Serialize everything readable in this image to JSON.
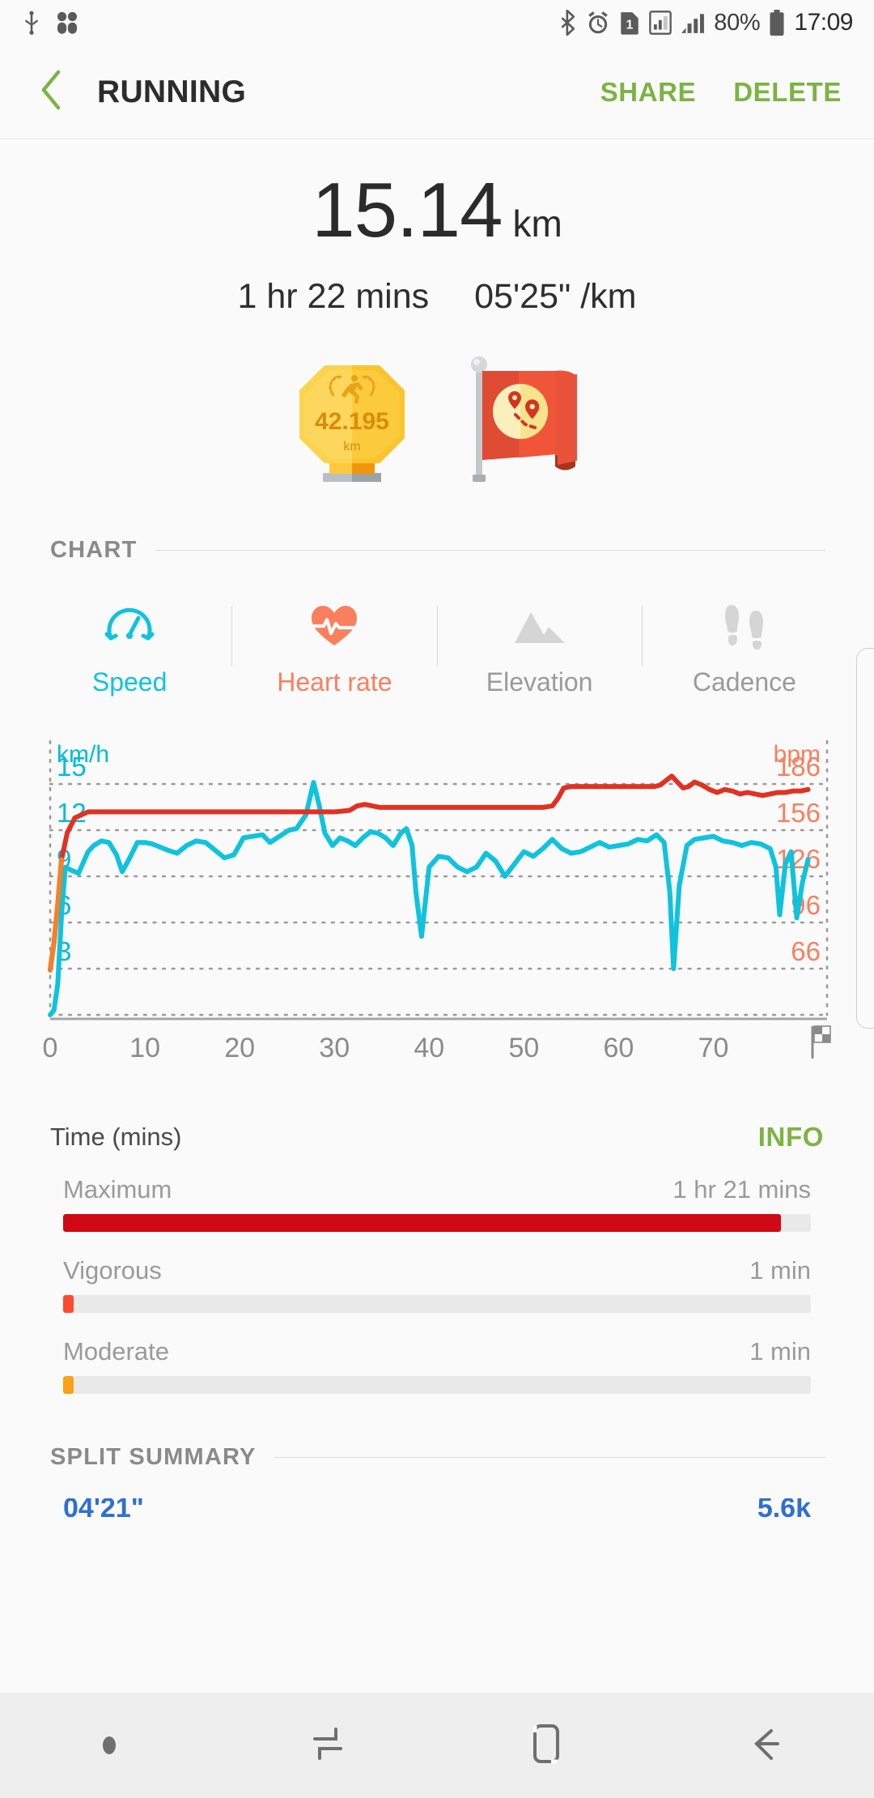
{
  "statusbar": {
    "time": "17:09",
    "battery_percent": "80%",
    "left_icons": [
      "usb-debug-icon",
      "apps-icon"
    ],
    "right_icons": [
      "bluetooth-icon",
      "alarm-icon",
      "sim-1-icon",
      "sd-card-icon",
      "signal-icon",
      "battery-icon"
    ]
  },
  "appbar": {
    "back_icon": "back-chevron-icon",
    "title": "RUNNING",
    "share_label": "SHARE",
    "delete_label": "DELETE",
    "accent_color": "#7cb342"
  },
  "summary": {
    "distance_value": "15.14",
    "distance_unit": "km",
    "duration": "1 hr 22 mins",
    "pace": "05'25\" /km"
  },
  "badges": [
    {
      "name": "marathon-medal-badge",
      "value": "42.195",
      "unit": "km"
    },
    {
      "name": "route-flag-badge",
      "value": "",
      "unit": ""
    }
  ],
  "chart_section": {
    "title": "CHART",
    "tabs": [
      {
        "label": "Speed",
        "icon": "speedometer-icon",
        "color": "#00bcd4",
        "active": true
      },
      {
        "label": "Heart rate",
        "icon": "heart-pulse-icon",
        "color": "#fa7f5e",
        "active": false
      },
      {
        "label": "Elevation",
        "icon": "mountain-icon",
        "color": "#9e9e9e",
        "active": false
      },
      {
        "label": "Cadence",
        "icon": "footsteps-icon",
        "color": "#9e9e9e",
        "active": false
      }
    ],
    "info_label": "INFO"
  },
  "chart_data": {
    "type": "line",
    "title": "",
    "xlabel": "Time (mins)",
    "x_ticks": [
      "0",
      "10",
      "20",
      "30",
      "40",
      "50",
      "60",
      "70"
    ],
    "x_end_marker": "finish-flag-icon",
    "xlim": [
      0,
      82
    ],
    "grid": true,
    "legend_position": "tabs-above",
    "axes": [
      {
        "side": "left",
        "unit_label": "km/h",
        "color": "#00bcd4",
        "ticks": [
          15,
          12,
          9,
          6,
          3
        ],
        "ylim": [
          0,
          16
        ]
      },
      {
        "side": "right",
        "unit_label": "bpm",
        "color": "#fa7f5e",
        "ticks": [
          186,
          156,
          126,
          96,
          66
        ],
        "ylim": [
          36,
          201
        ]
      }
    ],
    "series": [
      {
        "name": "Speed",
        "axis": "left",
        "unit": "km/h",
        "color": "#0fc3dd",
        "x": [
          0.0,
          0.4,
          0.8,
          1.2,
          1.6,
          2.2,
          3.0,
          4.0,
          4.6,
          5.4,
          6.2,
          7.0,
          7.6,
          8.4,
          9.2,
          10.0,
          10.8,
          11.6,
          12.4,
          13.4,
          14.4,
          15.4,
          16.4,
          17.4,
          18.4,
          19.4,
          20.4,
          21.4,
          22.4,
          23.2,
          24.2,
          25.2,
          26.0,
          27.0,
          27.8,
          28.4,
          29.0,
          29.8,
          30.6,
          31.4,
          32.2,
          33.0,
          33.8,
          34.6,
          35.4,
          36.2,
          37.0,
          37.6,
          38.2,
          38.6,
          39.2,
          40.0,
          41.0,
          42.0,
          43.0,
          44.0,
          45.0,
          46.0,
          47.0,
          48.0,
          49.0,
          50.0,
          51.0,
          52.0,
          53.0,
          54.0,
          55.0,
          56.0,
          57.0,
          58.0,
          59.0,
          60.0,
          61.0,
          62.0,
          63.0,
          64.0,
          64.8,
          65.4,
          65.8,
          66.4,
          67.2,
          68.0,
          69.0,
          70.0,
          71.0,
          72.0,
          73.0,
          74.0,
          75.0,
          76.0,
          76.6,
          77.0,
          77.6,
          78.2,
          78.8,
          79.4,
          80.0
        ],
        "y": [
          0.0,
          0.3,
          2.0,
          6.5,
          9.6,
          9.4,
          9.2,
          10.6,
          11.0,
          11.3,
          11.2,
          10.4,
          9.3,
          10.2,
          11.2,
          11.2,
          11.1,
          10.9,
          10.7,
          10.5,
          11.0,
          11.3,
          11.2,
          10.7,
          10.2,
          10.4,
          11.5,
          11.6,
          11.7,
          11.2,
          11.6,
          12.0,
          12.1,
          13.0,
          15.1,
          13.6,
          11.8,
          11.0,
          11.5,
          11.3,
          11.0,
          11.5,
          11.9,
          11.8,
          11.5,
          11.0,
          11.8,
          12.1,
          11.0,
          8.0,
          5.1,
          9.6,
          10.3,
          10.2,
          9.6,
          9.3,
          9.6,
          10.5,
          10.0,
          9.0,
          9.8,
          10.6,
          10.3,
          10.8,
          11.4,
          10.8,
          10.5,
          10.6,
          10.9,
          11.2,
          10.9,
          11.0,
          11.1,
          11.4,
          11.3,
          11.7,
          11.2,
          8.0,
          3.0,
          8.4,
          11.0,
          11.4,
          11.5,
          11.6,
          11.3,
          11.2,
          11.0,
          11.2,
          11.1,
          10.8,
          9.6,
          6.5,
          9.8,
          10.6,
          6.3,
          8.6,
          10.1
        ],
        "style": "solid",
        "width": 6
      },
      {
        "name": "Heart rate",
        "axis": "right",
        "unit": "bpm",
        "color": "#e23122",
        "x": [
          0.0,
          0.4,
          0.8,
          1.2,
          1.8,
          2.6,
          4.0,
          10.0,
          18.0,
          26.0,
          30.0,
          31.6,
          32.4,
          33.2,
          34.0,
          34.8,
          36.0,
          40.0,
          46.0,
          50.0,
          52.0,
          53.0,
          53.6,
          54.2,
          55.0,
          56.0,
          58.0,
          60.0,
          62.0,
          63.0,
          63.8,
          64.4,
          65.0,
          65.6,
          66.2,
          66.8,
          67.4,
          68.0,
          68.8,
          69.6,
          70.4,
          71.2,
          72.0,
          72.8,
          73.6,
          74.4,
          75.2,
          76.0,
          76.8,
          77.6,
          78.4,
          79.2,
          80.0
        ],
        "y": [
          66,
          84,
          110,
          140,
          158,
          168,
          172,
          172,
          172,
          172,
          172,
          173,
          176,
          177,
          176,
          175,
          175,
          175,
          175,
          175,
          175,
          176,
          181,
          188,
          189,
          189,
          189,
          189,
          189,
          189,
          189,
          190,
          193,
          196,
          192,
          188,
          189,
          192,
          190,
          187,
          185,
          187,
          186,
          184,
          185,
          184,
          183,
          184,
          185,
          185,
          186,
          186,
          187
        ],
        "style": "solid",
        "width": 6
      }
    ]
  },
  "zones": {
    "items": [
      {
        "label": "Maximum",
        "value": "1 hr 21 mins",
        "fill_percent": 96,
        "color": "#cf0a14"
      },
      {
        "label": "Vigorous",
        "value": "1 min",
        "fill_percent": 1.4,
        "color": "#fa4b32"
      },
      {
        "label": "Moderate",
        "value": "1 min",
        "fill_percent": 1.4,
        "color": "#f9a215"
      }
    ]
  },
  "split_summary": {
    "title": "SPLIT SUMMARY",
    "peek_left": "04'21\"",
    "peek_right": "5.6k"
  },
  "navbar": {
    "buttons": [
      "nav-dot-icon",
      "recents-icon",
      "home-icon",
      "back-icon"
    ]
  }
}
